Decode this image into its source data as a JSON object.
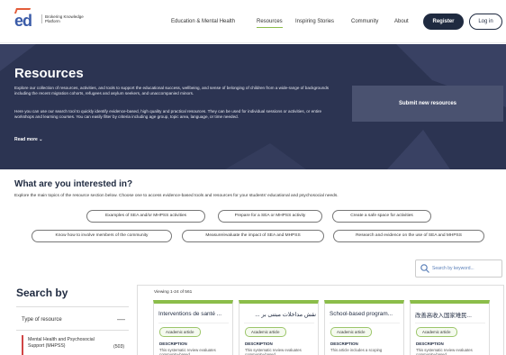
{
  "header": {
    "logo_mark": "ed",
    "logo_text": "Brokering Knowledge Platform",
    "nav": [
      {
        "label": "Education & Mental Health"
      },
      {
        "label": "Resources"
      },
      {
        "label": "Inspiring Stories"
      },
      {
        "label": "Community"
      },
      {
        "label": "About"
      }
    ],
    "register_label": "Register",
    "login_label": "Log in"
  },
  "hero": {
    "title": "Resources",
    "p1": "Explore our collection of resources, activities, and tools to support the educational success, wellbeing, and sense of belonging of children from a wide-range of backgrounds including the recent migration cohorts, refugees and asylum seekers, and unaccompanied minors.",
    "p2": "Here you can use our search tool to quickly identify evidence-based, high quality and practical resources. They can be used for individual sessions or activities, or entire workshops and learning courses. You can easily filter by criteria including age group, topic area, language, or time needed.",
    "read_more": "Read more",
    "submit_label": "Submit new resources"
  },
  "interests": {
    "title": "What are you interested in?",
    "desc": "Explore the main topics of the resource section below. Choose one to access evidence-based tools and resources for your students' educational and psychosocial needs.",
    "pills": [
      {
        "label": "Examples of SEA and/or MHPSS activities"
      },
      {
        "label": "Prepare for a SEA or MHPSS activity"
      },
      {
        "label": "Create a safe space for activities"
      },
      {
        "label": "Know how to involve members of the community"
      },
      {
        "label": "Measure/evaluate the impact of SEA and MHPSS"
      },
      {
        "label": "Research and evidence on the use of SEA and MHPSS"
      }
    ]
  },
  "search": {
    "keyword_placeholder": "Search by keyword...",
    "search_by_title": "Search by",
    "type_of_resource": "Type of resource",
    "type_toggle": "—",
    "filter_item_label": "Mental Health and Psychosocial Support (MHPSS)",
    "filter_item_count": "(503)"
  },
  "results": {
    "viewing": "Viewing 1-24 of 561",
    "cards": [
      {
        "title": "Interventions de santé ...",
        "badge": "Academic article",
        "label": "DESCRIPTION",
        "desc": "This systematic review evaluates community-based"
      },
      {
        "title": "نقش مداخلات مبتنی بر ...",
        "badge": "Academic article",
        "label": "DESCRIPTION",
        "desc": "This systematic review evaluates community-based"
      },
      {
        "title": "School-based program...",
        "badge": "Academic article",
        "label": "DESCRIPTION",
        "desc": "This article includes a scoping"
      },
      {
        "title": "改善高收入国家难民...",
        "badge": "Academic article",
        "label": "DESCRIPTION",
        "desc": "This systematic review evaluates community-based"
      }
    ]
  },
  "colors": {
    "navy": "#1f2a40",
    "hero_bg": "#2c3452",
    "accent_green": "#8bbd4a",
    "accent_red": "#d04545",
    "link_blue": "#5a7fb8"
  }
}
